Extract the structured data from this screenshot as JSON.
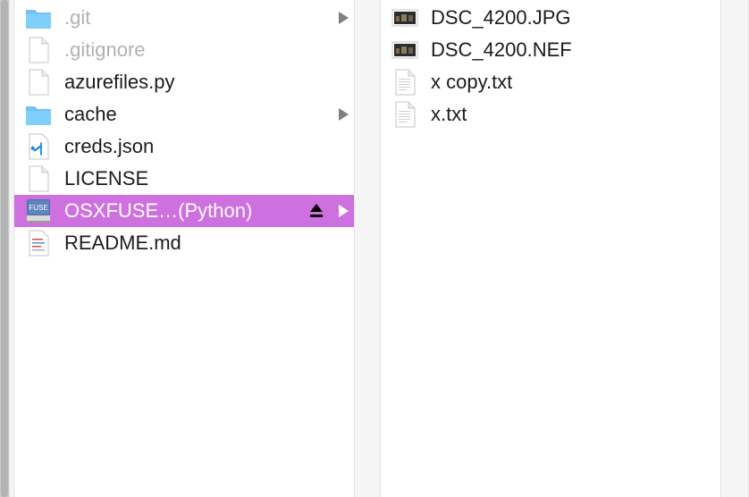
{
  "column1": {
    "items": [
      {
        "name": ".git",
        "icon": "folder-icon",
        "dim": true,
        "expandable": true
      },
      {
        "name": ".gitignore",
        "icon": "document-icon",
        "dim": true,
        "expandable": false
      },
      {
        "name": "azurefiles.py",
        "icon": "document-icon",
        "dim": false,
        "expandable": false
      },
      {
        "name": "cache",
        "icon": "folder-icon",
        "dim": false,
        "expandable": true
      },
      {
        "name": "creds.json",
        "icon": "vscode-file-icon",
        "dim": false,
        "expandable": false
      },
      {
        "name": "LICENSE",
        "icon": "document-icon",
        "dim": false,
        "expandable": false
      },
      {
        "name": "OSXFUSE…(Python)",
        "icon": "fuse-volume-icon",
        "dim": false,
        "expandable": true,
        "selected": true,
        "ejectable": true
      },
      {
        "name": "README.md",
        "icon": "text-document-icon",
        "dim": false,
        "expandable": false
      }
    ]
  },
  "column2": {
    "items": [
      {
        "name": "DSC_4200.JPG",
        "icon": "image-thumbnail-icon"
      },
      {
        "name": "DSC_4200.NEF",
        "icon": "image-thumbnail-icon"
      },
      {
        "name": "x copy.txt",
        "icon": "text-document-icon"
      },
      {
        "name": "x.txt",
        "icon": "text-document-icon"
      }
    ]
  },
  "colors": {
    "selection": "#cf70e0",
    "folder": "#6fc3f7",
    "dim_text": "#b2b2b2"
  }
}
